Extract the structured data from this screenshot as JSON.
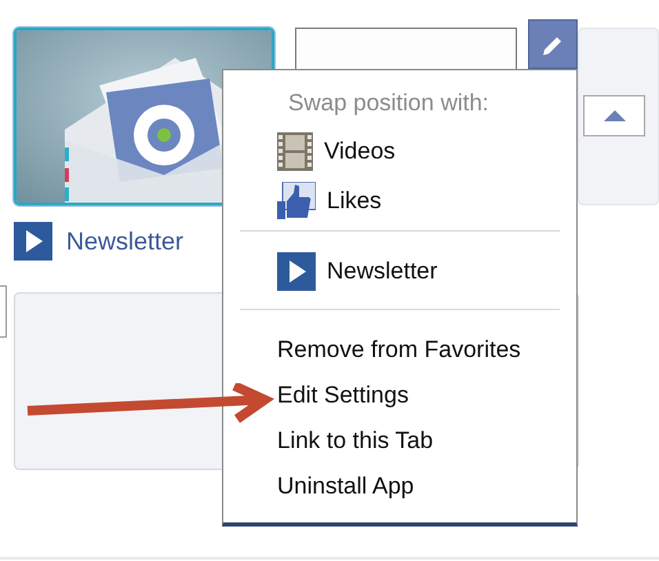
{
  "featured_app": {
    "caption": "Newsletter"
  },
  "menu": {
    "header": "Swap position with:",
    "swap_items": [
      {
        "kind": "film",
        "label": "Videos"
      },
      {
        "kind": "thumb",
        "label": "Likes"
      }
    ],
    "current": {
      "kind": "play",
      "label": "Newsletter"
    },
    "actions": [
      "Remove from Favorites",
      "Edit Settings",
      "Link to this Tab",
      "Uninstall App"
    ]
  }
}
